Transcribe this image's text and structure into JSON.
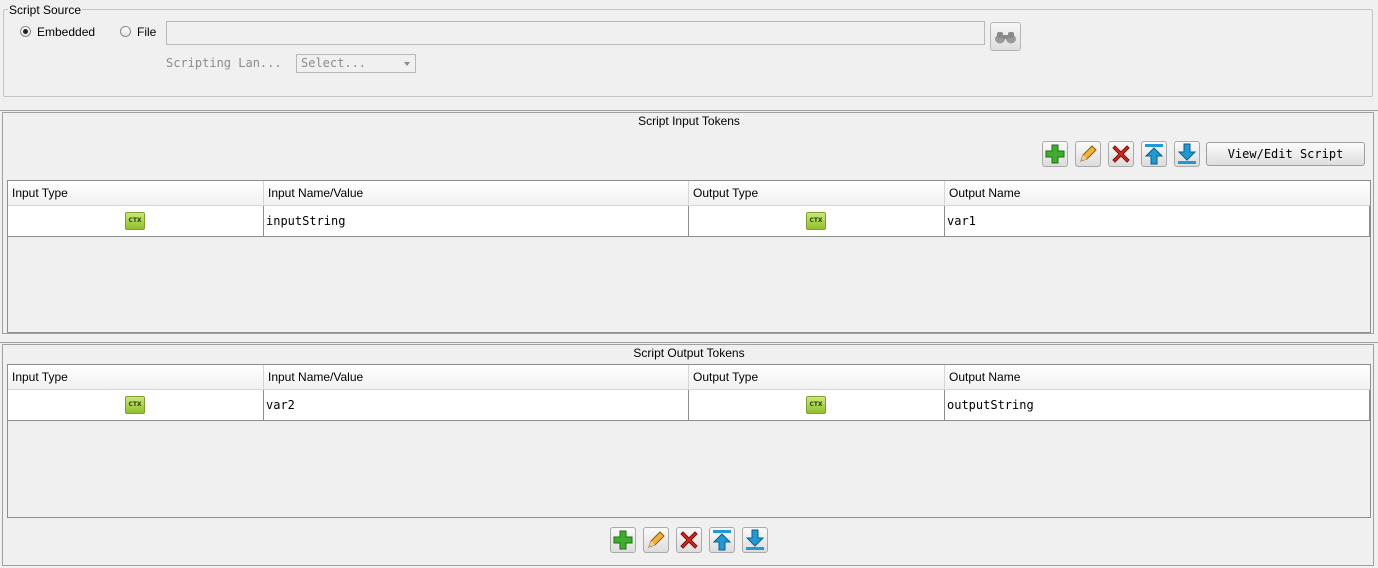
{
  "script_source": {
    "legend": "Script Source",
    "radio_embedded": "Embedded",
    "radio_file": "File",
    "file_path_value": "",
    "scripting_language_label": "Scripting Lan...",
    "scripting_language_select": "Select..."
  },
  "input_tokens": {
    "title": "Script Input Tokens",
    "view_edit_label": "View/Edit Script",
    "columns": [
      "Input Type",
      "Input Name/Value",
      "Output Type",
      "Output Name"
    ],
    "rows": [
      {
        "input_type": "CTX",
        "input_name": "inputString",
        "output_type": "CTX",
        "output_name": "var1"
      }
    ]
  },
  "output_tokens": {
    "title": "Script Output Tokens",
    "columns": [
      "Input Type",
      "Input Name/Value",
      "Output Type",
      "Output Name"
    ],
    "rows": [
      {
        "input_type": "CTX",
        "input_name": "var2",
        "output_type": "CTX",
        "output_name": "outputString"
      }
    ]
  },
  "toolbar_icons": [
    "add-icon",
    "edit-icon",
    "delete-icon",
    "move-up-icon",
    "move-down-icon"
  ],
  "colors": {
    "ctx_badge": "#a6cf43",
    "add_green": "#3fae2a",
    "delete_red": "#d9261c",
    "arrow_blue": "#1e9ad6"
  }
}
